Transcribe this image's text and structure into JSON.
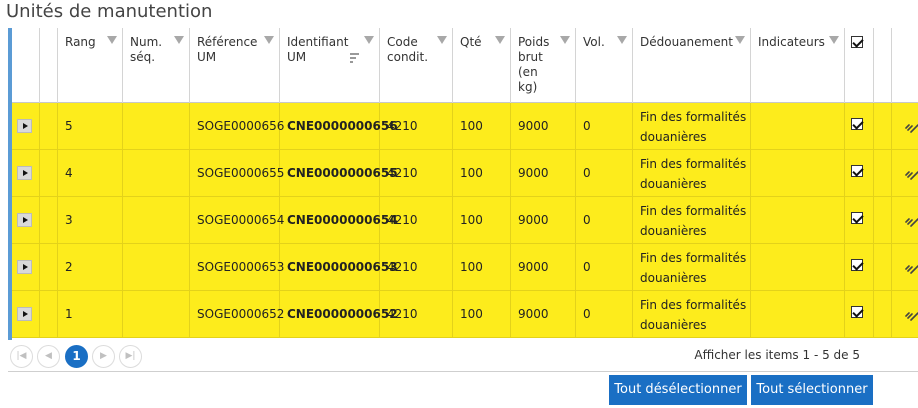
{
  "page_title": "Unités de manutention",
  "header": {
    "rang": "Rang",
    "num_seq": "Num. séq.",
    "reference_um": "Référence UM",
    "identifiant_um": "Identifiant UM",
    "code_condit": "Code condit.",
    "qte": "Qté",
    "poids_brut": "Poids brut (en kg)",
    "vol": "Vol.",
    "dedouanement": "Dédouanement",
    "indicateurs": "Indicateurs"
  },
  "rows": [
    {
      "rang": "5",
      "num_seq": "",
      "reference_um": "SOGE0000656",
      "identifiant_um": "CNE0000000656",
      "code_condit": "4210",
      "qte": "100",
      "poids_brut": "9000",
      "vol": "0",
      "dedouanement": "Fin des formalités douanières",
      "indicateurs": "",
      "checked": true
    },
    {
      "rang": "4",
      "num_seq": "",
      "reference_um": "SOGE0000655",
      "identifiant_um": "CNE0000000655",
      "code_condit": "4210",
      "qte": "100",
      "poids_brut": "9000",
      "vol": "0",
      "dedouanement": "Fin des formalités douanières",
      "indicateurs": "",
      "checked": true
    },
    {
      "rang": "3",
      "num_seq": "",
      "reference_um": "SOGE0000654",
      "identifiant_um": "CNE0000000654",
      "code_condit": "4210",
      "qte": "100",
      "poids_brut": "9000",
      "vol": "0",
      "dedouanement": "Fin des formalités douanières",
      "indicateurs": "",
      "checked": true
    },
    {
      "rang": "2",
      "num_seq": "",
      "reference_um": "SOGE0000653",
      "identifiant_um": "CNE0000000653",
      "code_condit": "4210",
      "qte": "100",
      "poids_brut": "9000",
      "vol": "0",
      "dedouanement": "Fin des formalités douanières",
      "indicateurs": "",
      "checked": true
    },
    {
      "rang": "1",
      "num_seq": "",
      "reference_um": "SOGE0000652",
      "identifiant_um": "CNE0000000652",
      "code_condit": "4210",
      "qte": "100",
      "poids_brut": "9000",
      "vol": "0",
      "dedouanement": "Fin des formalités douanières",
      "indicateurs": "",
      "checked": true
    }
  ],
  "pager": {
    "current_page": "1",
    "info": "Afficher les items 1 - 5 de 5"
  },
  "buttons": {
    "deselect_all": "Tout désélectionner",
    "select_all": "Tout sélectionner"
  },
  "colors": {
    "row_highlight": "#fdec1c",
    "accent_blue": "#1a6fc4",
    "grid_left_bar": "#5b9bd5"
  }
}
